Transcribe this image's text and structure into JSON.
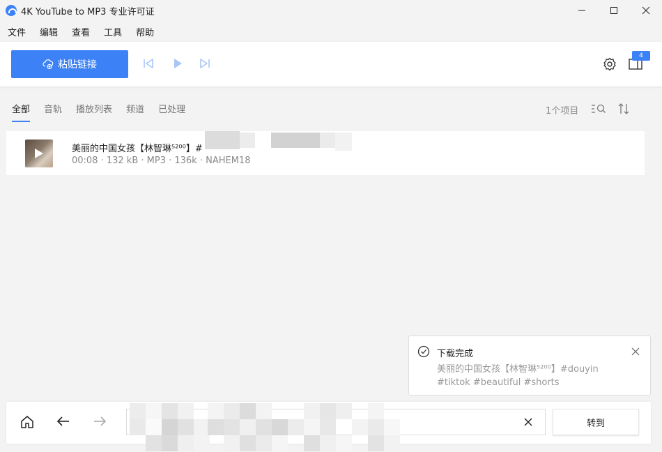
{
  "window": {
    "title": "4K YouTube to MP3 专业许可证"
  },
  "menu": [
    "文件",
    "编辑",
    "查看",
    "工具",
    "帮助"
  ],
  "toolbar": {
    "paste_label": "粘贴链接",
    "badge_count": "4"
  },
  "tabs": [
    "全部",
    "音轨",
    "播放列表",
    "频道",
    "已处理"
  ],
  "items_count": "1个项目",
  "item": {
    "title": "美丽的中国女孩【林智琳⁵²⁰⁰】#",
    "meta": "00:08 · 132 kB · MP3 · 136k · NAHEM18"
  },
  "toast": {
    "title": "下载完成",
    "line1": "美丽的中国女孩【林智琳⁵²⁰⁰】#douyin",
    "line2": "#tiktok #beautiful #shorts"
  },
  "bottom": {
    "go_label": "转到"
  },
  "colors": {
    "accent": "#3c82f6",
    "disabled_icon": "#a9c6f7"
  }
}
